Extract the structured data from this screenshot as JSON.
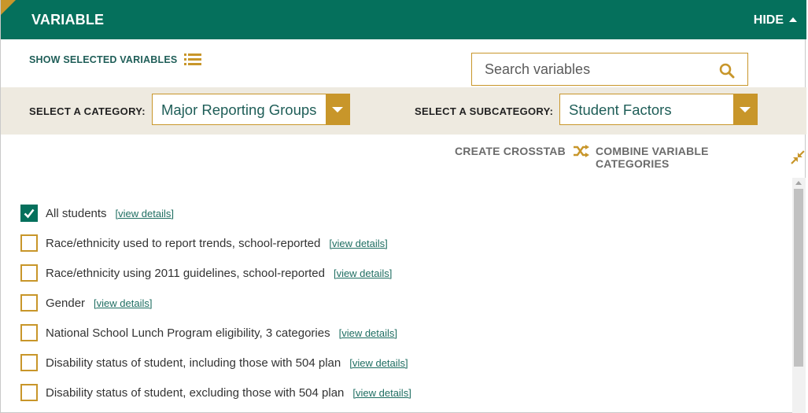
{
  "header": {
    "title": "VARIABLE",
    "hide_label": "HIDE"
  },
  "toolbar": {
    "show_selected_label": "SHOW SELECTED VARIABLES"
  },
  "search": {
    "placeholder": "Search variables",
    "value": ""
  },
  "category": {
    "label": "SELECT A CATEGORY:",
    "selected": "Major Reporting Groups"
  },
  "subcategory": {
    "label": "SELECT A SUBCATEGORY:",
    "selected": "Student Factors"
  },
  "actions": {
    "crosstab_label": "CREATE CROSSTAB",
    "combine_label": "COMBINE VARIABLE CATEGORIES"
  },
  "variables": [
    {
      "label": "All students",
      "details": "[view details]",
      "checked": true
    },
    {
      "label": "Race/ethnicity used to report trends, school-reported",
      "details": "[view details]",
      "checked": false
    },
    {
      "label": "Race/ethnicity using 2011 guidelines, school-reported",
      "details": "[view details]",
      "checked": false
    },
    {
      "label": "Gender",
      "details": "[view details]",
      "checked": false
    },
    {
      "label": "National School Lunch Program eligibility, 3 categories",
      "details": "[view details]",
      "checked": false
    },
    {
      "label": "Disability status of student, including those with 504 plan",
      "details": "[view details]",
      "checked": false
    },
    {
      "label": "Disability status of student, excluding those with 504 plan",
      "details": "[view details]",
      "checked": false
    }
  ],
  "icons": {
    "hide": "caret-up-icon",
    "show_selected": "list-icon",
    "search": "search-icon",
    "dropdown": "chevron-down-icon",
    "crosstab": "shuffle-icon",
    "combine": "collapse-arrows-icon",
    "checked": "checkmark-icon"
  },
  "colors": {
    "header": "#05705c",
    "accent": "#c8962a",
    "category_bar": "#eeeae0",
    "link": "#1f6e62"
  }
}
